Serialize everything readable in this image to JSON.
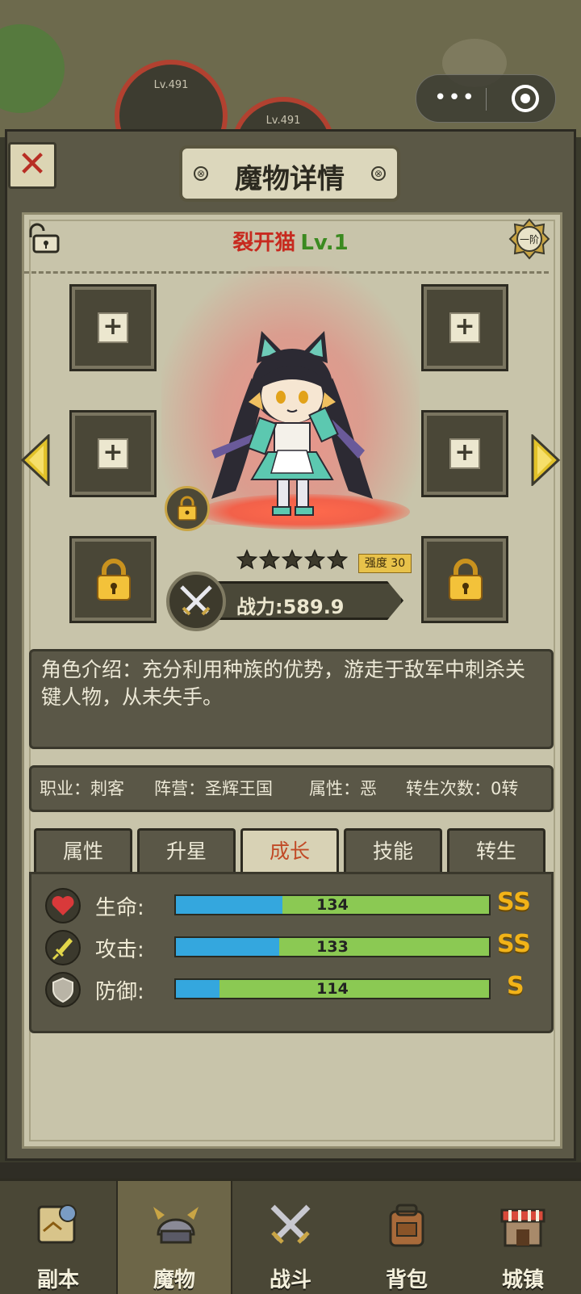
{
  "topbar": {
    "level_badges": [
      "Lv.491",
      "Lv.491"
    ],
    "capsule_more": "•••",
    "capsule_close": "target"
  },
  "dialog": {
    "title": "魔物详情",
    "close": "✕"
  },
  "monster": {
    "name": "裂开猫",
    "level": "Lv.1",
    "rank": "一阶",
    "stars": 5,
    "strength_label": "强度 30",
    "power": "战力:589.9"
  },
  "intro": {
    "text": "角色介绍：充分利用种族的优势，游走于敌军中刺杀关键人物，从未失手。"
  },
  "info": {
    "job": "职业：刺客",
    "camp": "阵营：圣辉王国",
    "attr": "属性：恶",
    "rebirth": "转生次数：0转"
  },
  "tabs": [
    {
      "label": "属性"
    },
    {
      "label": "升星"
    },
    {
      "label": "成长"
    },
    {
      "label": "技能"
    },
    {
      "label": "转生"
    }
  ],
  "stats": [
    {
      "label": "生命:",
      "value": "134",
      "blue_ratio": 0.34,
      "grade": "SS",
      "icon": "heart-icon"
    },
    {
      "label": "攻击:",
      "value": "133",
      "blue_ratio": 0.33,
      "grade": "SS",
      "icon": "sword-icon"
    },
    {
      "label": "防御:",
      "value": "114",
      "blue_ratio": 0.14,
      "grade": "S",
      "icon": "shield-icon"
    }
  ],
  "nav": [
    {
      "label": "副本",
      "icon": "map-icon"
    },
    {
      "label": "魔物",
      "icon": "helmet-icon"
    },
    {
      "label": "战斗",
      "icon": "crossed-swords-icon"
    },
    {
      "label": "背包",
      "icon": "backpack-icon"
    },
    {
      "label": "城镇",
      "icon": "shop-icon"
    }
  ],
  "colors": {
    "name": "#c72a1f",
    "level": "#3b8a20",
    "bar_blue": "#34a7de",
    "bar_green": "#8bc953",
    "grade": "#f2b318"
  }
}
